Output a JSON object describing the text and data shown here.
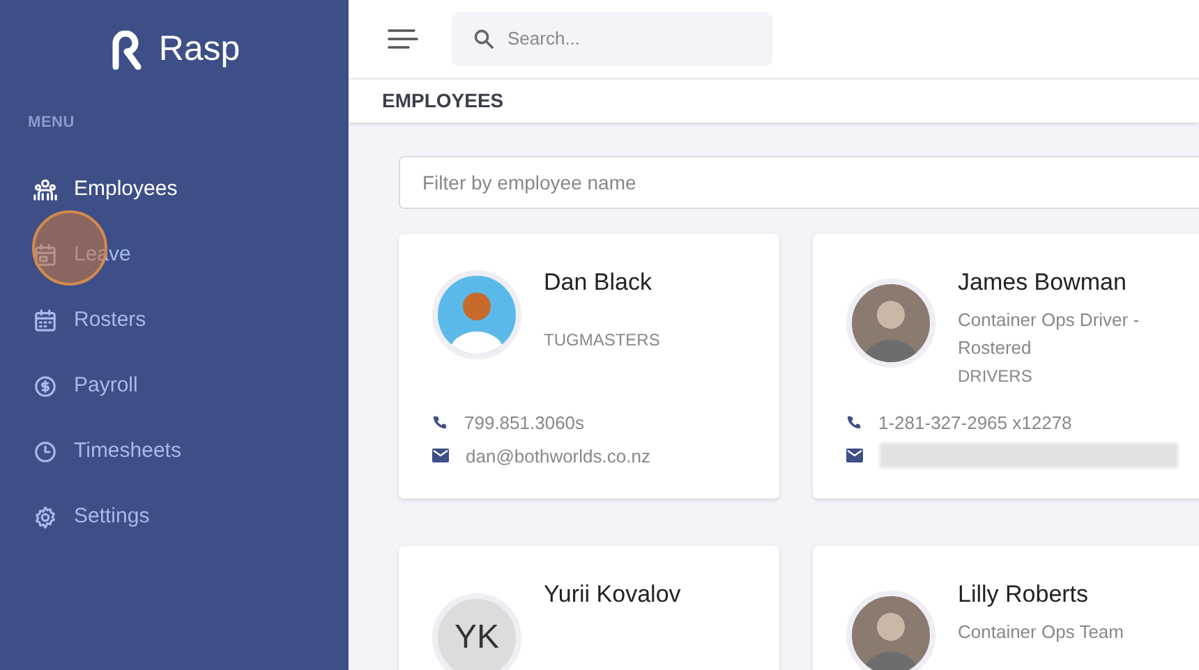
{
  "brand": {
    "name": "Rasp"
  },
  "sidebar": {
    "heading": "MENU",
    "items": [
      {
        "label": "Employees",
        "selected": true
      },
      {
        "label": "Leave",
        "selected": false
      },
      {
        "label": "Rosters",
        "selected": false
      },
      {
        "label": "Payroll",
        "selected": false
      },
      {
        "label": "Timesheets",
        "selected": false
      },
      {
        "label": "Settings",
        "selected": false
      }
    ]
  },
  "search": {
    "placeholder": "Search..."
  },
  "page_title": "EMPLOYEES",
  "filter": {
    "placeholder": "Filter by employee name"
  },
  "employees": [
    {
      "name": "Dan Black",
      "kind": "illustration",
      "department": "TUGMASTERS",
      "phone": "799.851.3060s",
      "email": "dan@bothworlds.co.nz"
    },
    {
      "name": "James Bowman",
      "kind": "photo",
      "role": "Container Ops Driver - Rostered",
      "department": "DRIVERS",
      "phone": "1-281-327-2965 x12278",
      "email_redacted": true
    },
    {
      "name": "Yurii Kovalov",
      "kind": "initials",
      "initials": "YK"
    },
    {
      "name": "Lilly Roberts",
      "kind": "photo",
      "role": "Container Ops Team"
    }
  ]
}
